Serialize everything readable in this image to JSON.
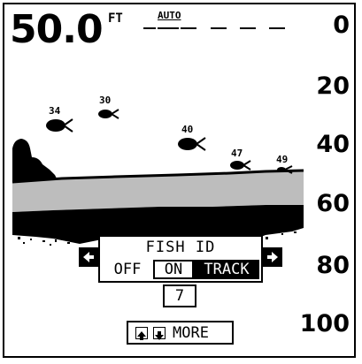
{
  "header": {
    "depth_value": "50.0",
    "depth_unit": "FT",
    "range_mode": "AUTO"
  },
  "depth_scale": [
    "0",
    "20",
    "40",
    "60",
    "80",
    "100"
  ],
  "fish": [
    {
      "depth_label": "34",
      "icon": "fish-icon"
    },
    {
      "depth_label": "30",
      "icon": "fish-icon"
    },
    {
      "depth_label": "40",
      "icon": "fish-icon"
    },
    {
      "depth_label": "47",
      "icon": "fish-icon"
    },
    {
      "depth_label": "49",
      "icon": "fish-icon"
    }
  ],
  "fish_id_menu": {
    "title": "FISH ID",
    "options": [
      "OFF",
      "ON",
      "TRACK"
    ],
    "selected": "TRACK",
    "value": "7",
    "left_arrow_icon": "arrow-left-icon",
    "right_arrow_icon": "arrow-right-icon"
  },
  "footer": {
    "more_label": "MORE",
    "up_icon": "arrow-up-icon",
    "down_icon": "arrow-down-icon"
  },
  "colors": {
    "background": "#ffffff",
    "ink": "#000000",
    "grayline": "#bdbdbd"
  }
}
